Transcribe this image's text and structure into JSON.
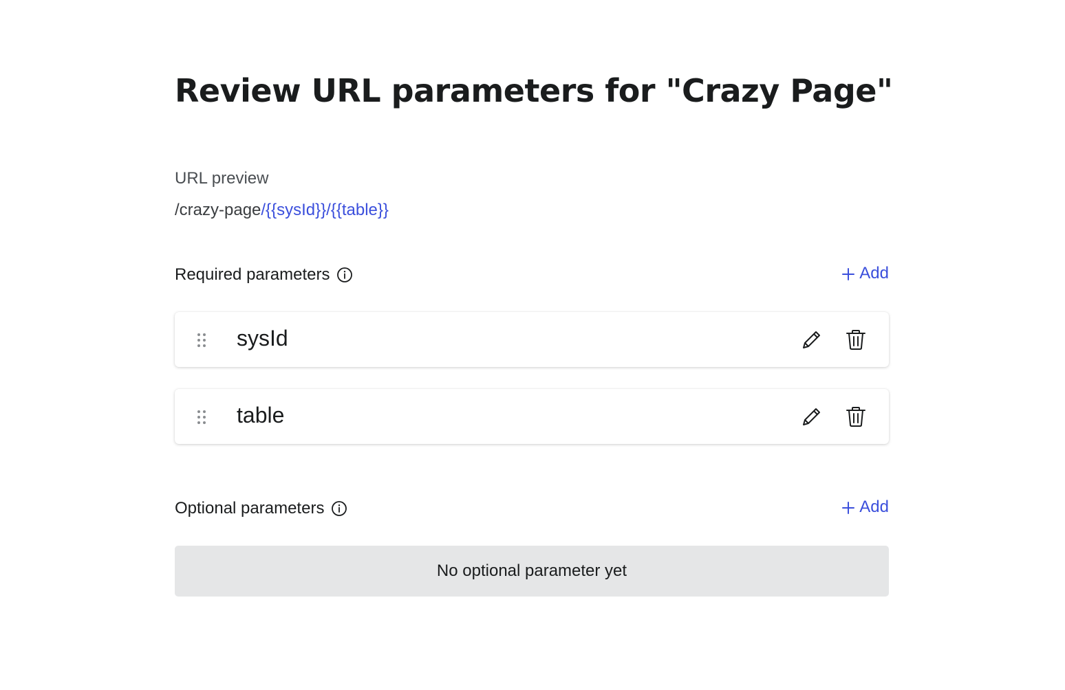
{
  "page": {
    "title": "Review URL parameters for \"Crazy Page\""
  },
  "url_preview": {
    "label": "URL preview",
    "base": "/crazy-page",
    "params_text": "/{{sysId}}/{{table}}"
  },
  "required_section": {
    "title": "Required parameters",
    "add_label": "Add",
    "info_icon": "info-circle-icon",
    "items": [
      {
        "name": "sysId"
      },
      {
        "name": "table"
      }
    ]
  },
  "optional_section": {
    "title": "Optional parameters",
    "add_label": "Add",
    "info_icon": "info-circle-icon",
    "empty_text": "No optional parameter yet"
  },
  "colors": {
    "accent": "#3b4fdc",
    "text": "#1a1c1d",
    "empty_bg": "#e5e6e7"
  }
}
